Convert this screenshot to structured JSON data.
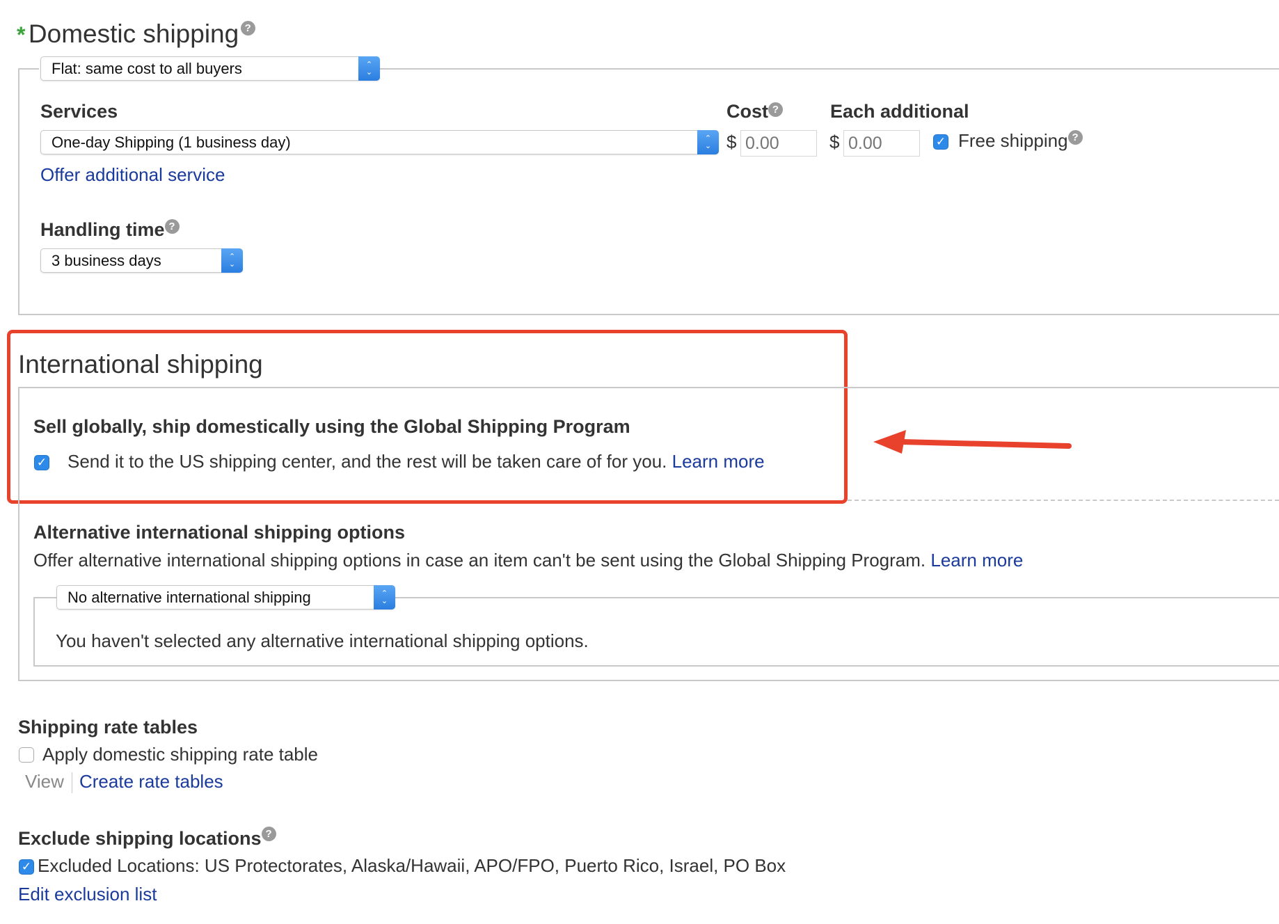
{
  "domestic": {
    "required_mark": "*",
    "title": "Domestic shipping",
    "help": "?",
    "type_select": "Flat: same cost to all buyers",
    "services_label": "Services",
    "service_select": "One-day Shipping (1 business day)",
    "cost_label": "Cost",
    "each_label": "Each additional",
    "currency": "$",
    "cost_placeholder": "0.00",
    "each_placeholder": "0.00",
    "free_shipping_label": "Free shipping",
    "offer_link": "Offer additional service",
    "handling_label": "Handling time",
    "handling_select": "3 business days"
  },
  "international": {
    "title": "International shipping",
    "gsp_heading": "Sell globally, ship domestically using the Global Shipping Program",
    "gsp_text": "Send it to the US shipping center, and the rest will be taken care of for you.",
    "gsp_link": "Learn more",
    "alt_heading": "Alternative international shipping options",
    "alt_text": "Offer alternative international shipping options in case an item can't be sent using the Global Shipping Program.",
    "alt_link": "Learn more",
    "alt_select": "No alternative international shipping",
    "alt_none": "You haven't selected any alternative international shipping options."
  },
  "rate_tables": {
    "heading": "Shipping rate tables",
    "apply_label": "Apply domestic shipping rate table",
    "view_label": "View",
    "create_link": "Create rate tables"
  },
  "exclude": {
    "heading": "Exclude shipping locations",
    "excluded_text": "Excluded Locations: US Protectorates, Alaska/Hawaii, APO/FPO, Puerto Rico, Israel, PO Box",
    "edit_link": "Edit exclusion list"
  },
  "colors": {
    "highlight": "#e8412c",
    "link": "#1a3a9c",
    "checkbox": "#2d8ae8",
    "required": "#3aa33a"
  }
}
